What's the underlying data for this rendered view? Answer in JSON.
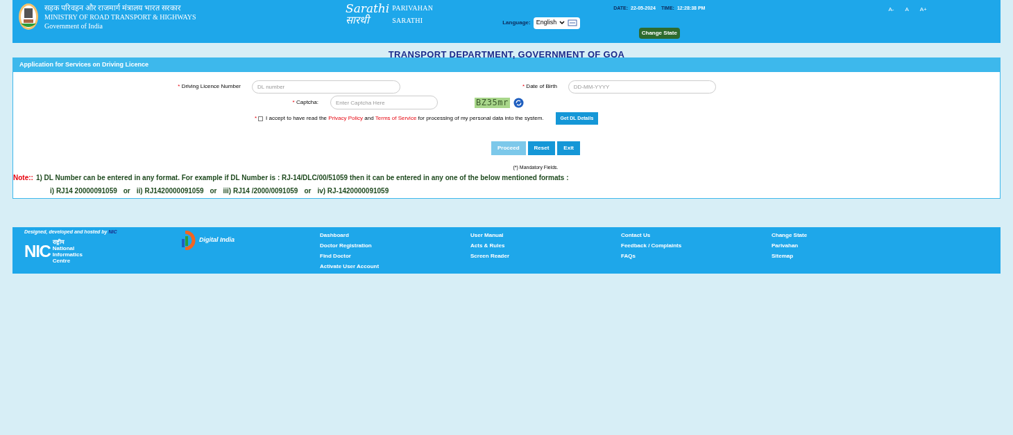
{
  "header": {
    "ministry_hindi": "सड़क परिवहन और राजमार्ग मंत्रालय भारत सरकार",
    "ministry": "MINISTRY OF ROAD TRANSPORT & HIGHWAYS",
    "government": "Government of India",
    "logo_latin": "Sarathi",
    "logo_hindi": "सारथी",
    "brand_1": "PARIVAHAN",
    "brand_2": "SARATHI",
    "date_label": "DATE:",
    "date": "22-05-2024",
    "time_label": "TIME:",
    "time": "12:28:38 PM",
    "language_label": "Language:",
    "language": "English",
    "font_sizes": [
      "A-",
      "A",
      "A+"
    ],
    "change_state": "Change State"
  },
  "department": "TRANSPORT DEPARTMENT, GOVERNMENT OF GOA",
  "form": {
    "title": "Application for Services on Driving Licence",
    "dl_label": "Driving Licence Number",
    "dl_placeholder": "DL number",
    "dob_label": "Date of Birth",
    "dob_placeholder": "DD-MM-YYYY",
    "captcha_label": "Captcha:",
    "captcha_placeholder": "Enter Captcha Here",
    "captcha_image": "BZ35mr",
    "required_mark": "*",
    "consent": {
      "checked": false,
      "before": "I accept to have read the",
      "link_1": "Privacy Policy",
      "middle": "and",
      "link_2": "Terms of Service",
      "after": "for processing of my personal data into the system."
    },
    "get_details": "Get DL Details",
    "buttons": [
      {
        "label": "Proceed",
        "disabled": true
      },
      {
        "label": "Reset",
        "disabled": false
      },
      {
        "label": "Exit",
        "disabled": false
      }
    ],
    "mandatory": "(*) Mandatory Fields.",
    "note_label": "Note::",
    "note": "1) DL Number can be entered in any format. For example if DL Number is : RJ-14/DLC/00/51059 then it can be entered in any one of the below mentioned formats :",
    "formats": [
      "i) RJ14 20000091059",
      "or",
      "ii) RJ1420000091059",
      "or",
      "iii) RJ14 /2000/0091059",
      "or",
      "iv) RJ-1420000091059"
    ]
  },
  "footer": {
    "credit": "Designed, developed and hosted by",
    "credit_org": "NIC",
    "nic": "NIC",
    "nic_hindi": "राष्ट्रीय",
    "nic_name": "National Informatics Centre",
    "digital_india": "Digital India",
    "link_columns": [
      [
        "Dashboard",
        "Doctor Registration",
        "Find Doctor",
        "Activate User Account"
      ],
      [
        "User Manual",
        "Acts & Rules",
        "Screen Reader"
      ],
      [
        "Contact Us",
        "Feedback / Complaints",
        "FAQs"
      ],
      [
        "Change State",
        "Parivahan",
        "Sitemap"
      ]
    ]
  }
}
